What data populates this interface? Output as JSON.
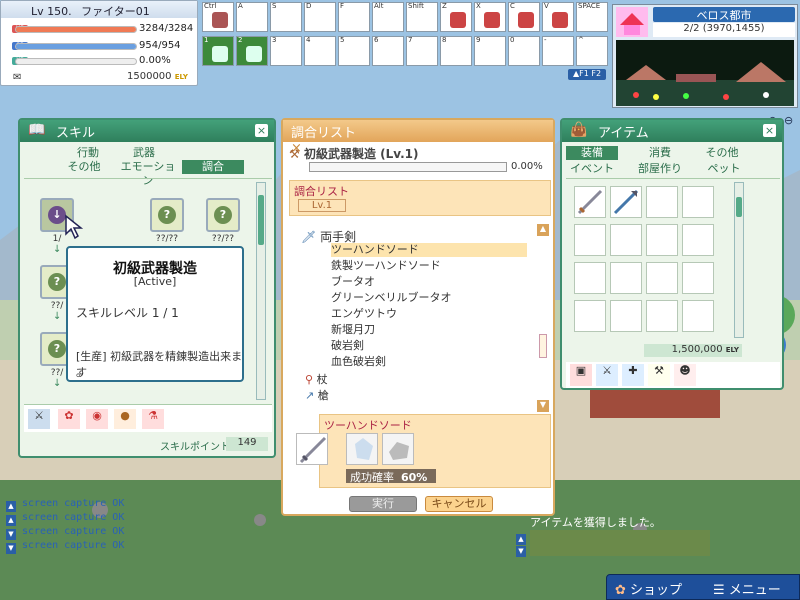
{
  "player": {
    "level": "Lv 150.",
    "name": "ファイター01",
    "hp": {
      "label": "HP",
      "value": "3284/3284",
      "ratio": 1.0
    },
    "sp": {
      "label": "SP",
      "value": "954/954",
      "ratio": 1.0
    },
    "xp": {
      "label": "XP",
      "value": "0.00%",
      "ratio": 0.0
    },
    "ely": "1500000",
    "ely_unit": "ELY"
  },
  "hotbar": {
    "keys_top": [
      "Ctrl",
      "A",
      "S",
      "D",
      "F",
      "Alt",
      "Shift",
      "Z",
      "X",
      "C",
      "V",
      "SPACE"
    ],
    "keys_bottom": [
      "1",
      "2",
      "3",
      "4",
      "5",
      "6",
      "7",
      "8",
      "9",
      "0",
      "-",
      "^"
    ],
    "page": "F1",
    "page2": "F2"
  },
  "map": {
    "title": "ベロス都市",
    "coords": "2/2 (3970,1455)"
  },
  "skill": {
    "title": "スキル",
    "tabs": [
      "行動",
      "武器",
      "その他",
      "エモーション",
      "調合"
    ],
    "selected_tab": "調合",
    "lv_labels": [
      "1/",
      "??/??",
      "??/??",
      "??/",
      "??/",
      "??/"
    ],
    "points_label": "スキルポイント",
    "points_value": "149"
  },
  "tooltip": {
    "title": "初級武器製造",
    "type": "[Active]",
    "level": "スキルレベル 1 / 1",
    "desc": "[生産] 初級武器を精錬製造出来ます",
    "desc2": "。"
  },
  "craft": {
    "title": "調合リスト",
    "skill": "初級武器製造 (Lv.1)",
    "progress": "0.00%",
    "list_header": "調合リスト",
    "list_lv": "Lv.1",
    "category": "両手剣",
    "recipes": [
      "ツーハンドソード",
      "鉄製ツーハンドソード",
      "ブータオ",
      "グリーンベリルブータオ",
      "エンゲツトウ",
      "新堰月刀",
      "破岩剣",
      "血色破岩剣"
    ],
    "selected_recipe": "ツーハンドソード",
    "other_categories": [
      "杖",
      "槍"
    ],
    "selected_name": "ツーハンドソード",
    "rate_label": "成功確率",
    "rate_value": "60%",
    "exec": "実行",
    "cancel": "キャンセル"
  },
  "items": {
    "title": "アイテム",
    "tabs": [
      "装備",
      "消費",
      "その他",
      "イベント",
      "部屋作り",
      "ペット"
    ],
    "selected_tab": "装備",
    "money": "1,500,000",
    "money_unit": "ELY"
  },
  "chat": {
    "lines": [
      "screen capture OK",
      "screen capture OK",
      "screen capture OK",
      "screen capture OK"
    ]
  },
  "notice": "アイテムを獲得しました。",
  "bottom": {
    "shop": "ショップ",
    "menu": "メニュー"
  }
}
